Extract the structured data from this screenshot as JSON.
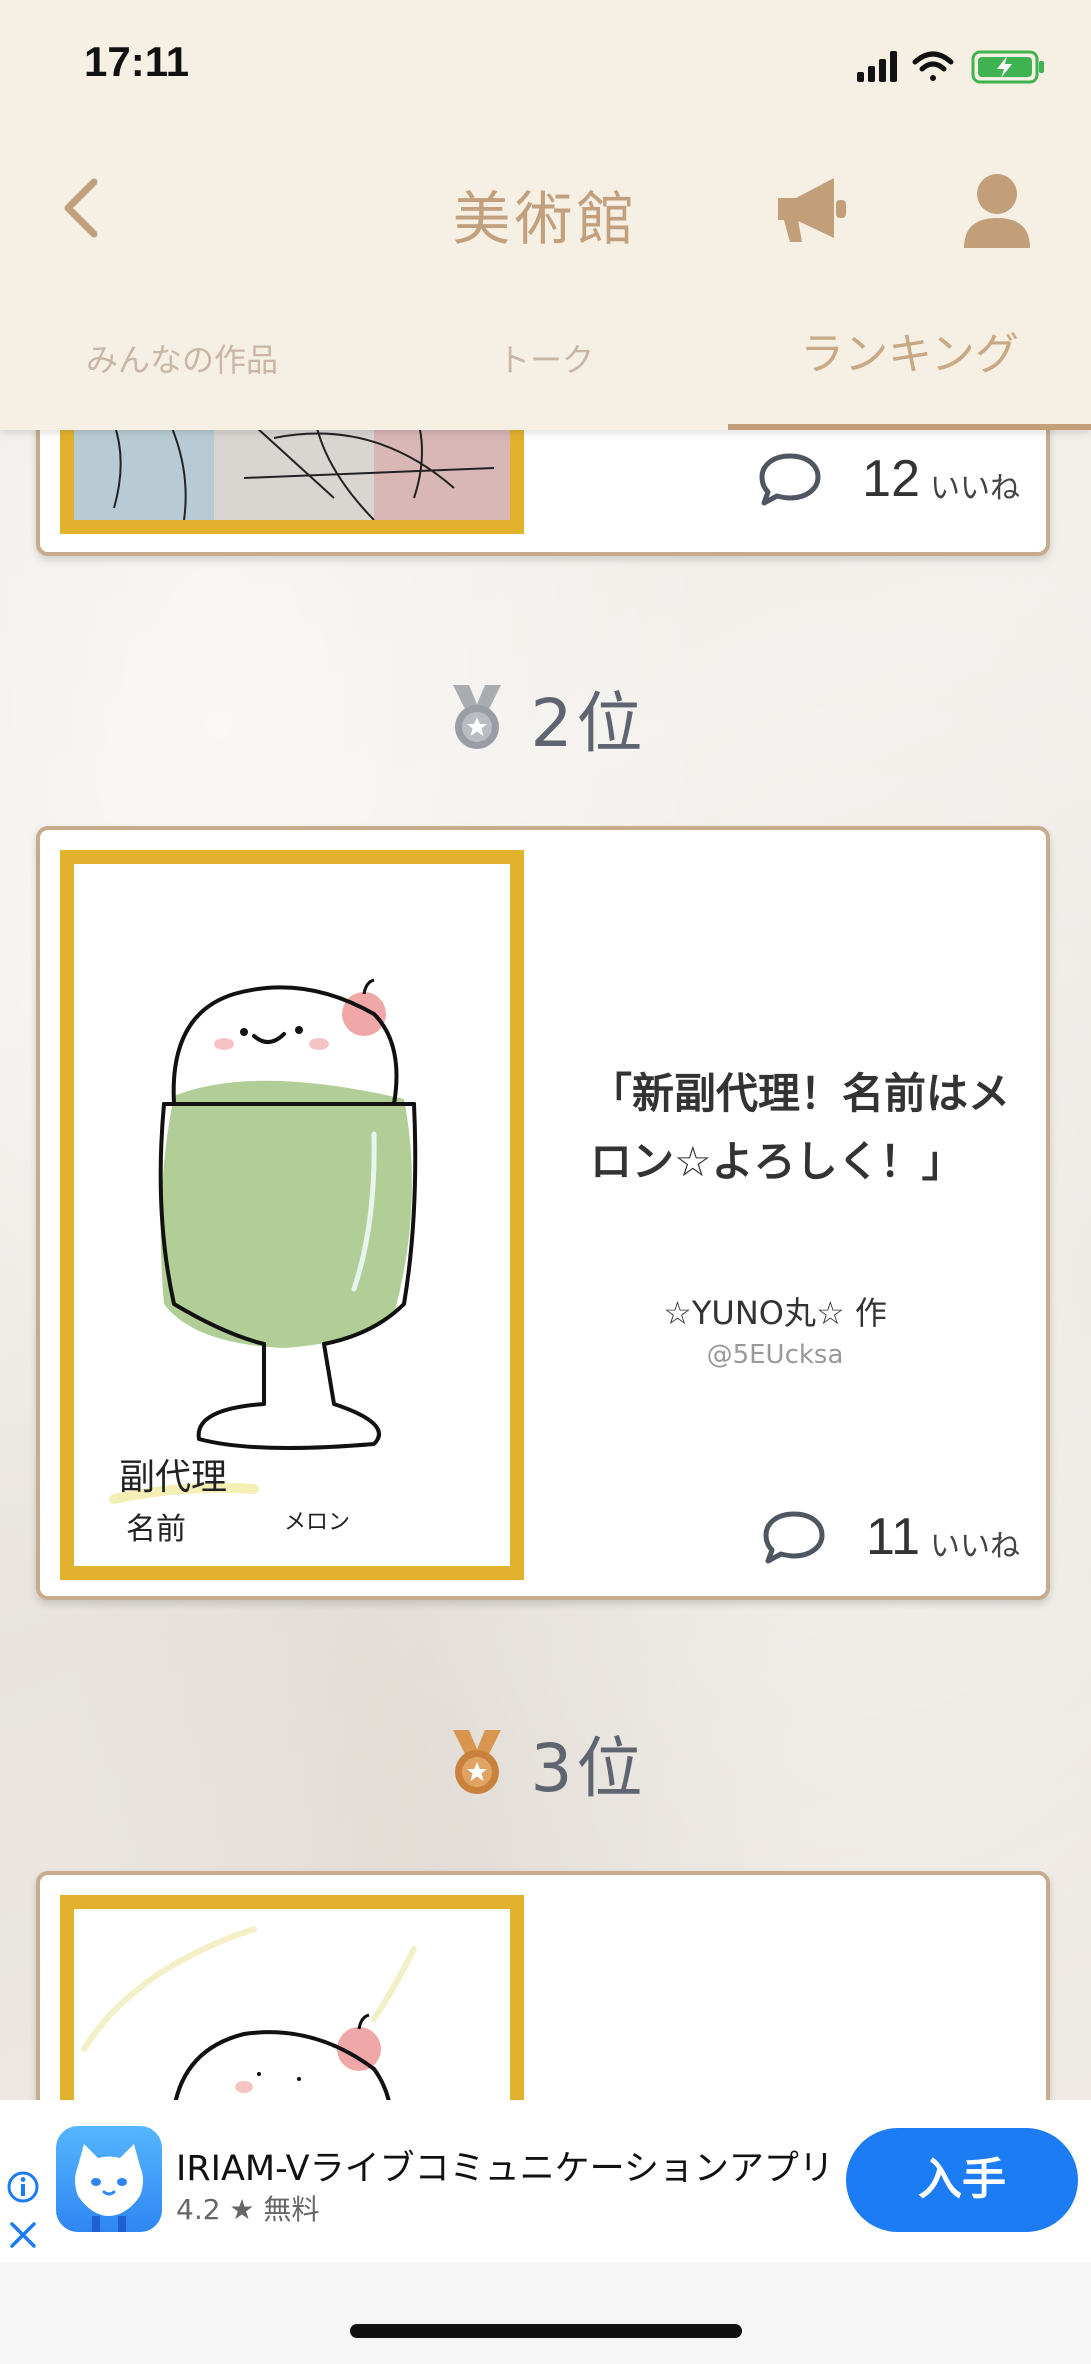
{
  "status_bar": {
    "time": "17:11"
  },
  "header": {
    "title": "美術館"
  },
  "tabs": [
    {
      "label": "みんなの作品"
    },
    {
      "label": "トーク"
    },
    {
      "label": "ランキング",
      "active": true
    }
  ],
  "rankings": [
    {
      "likes": "12",
      "likes_unit": "いいね"
    },
    {
      "rank": "2位",
      "medal": "silver",
      "title": "「新副代理！名前はメロン☆よろしく！」",
      "artist": "☆YUNO丸☆ 作",
      "handle": "@5EUcksa",
      "likes": "11",
      "likes_unit": "いいね",
      "drawing_text": {
        "line1": "副代理",
        "line2": "名前",
        "line3": "メロン"
      }
    },
    {
      "rank": "3位",
      "medal": "bronze"
    }
  ],
  "ad": {
    "app_name": "IRIAM-Vライブコミュニケーションアプリ",
    "rating": "4.2 ★ 無料",
    "get_label": "入手"
  },
  "colors": {
    "header_bg": "#f6efe4",
    "accent": "#c29e79",
    "frame_gold": "#e2b22e",
    "ad_button": "#1b7cf4"
  }
}
